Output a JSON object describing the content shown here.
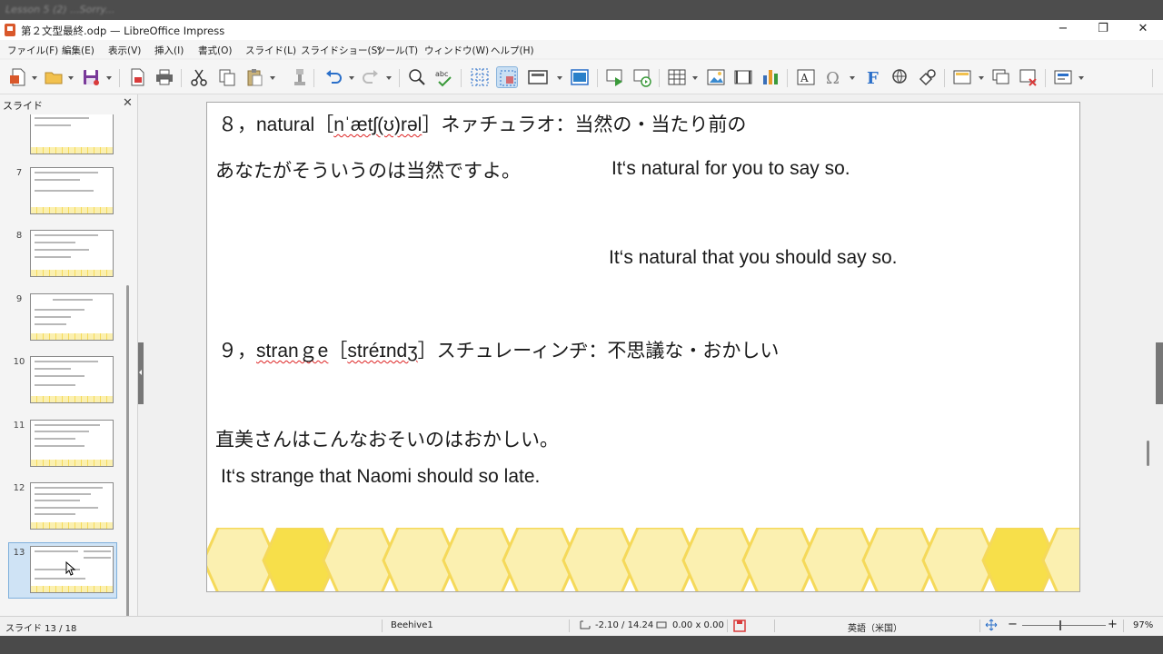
{
  "top_strip": {
    "text": "Lesson 5 (2) ...Sorry..."
  },
  "window": {
    "title": "第２文型最終.odp — LibreOffice Impress",
    "controls": {
      "minimize": "−",
      "maximize": "❐",
      "close": "✕"
    }
  },
  "menu": [
    "ファイル(F)",
    "編集(E)",
    "表示(V)",
    "挿入(I)",
    "書式(O)",
    "スライド(L)",
    "スライドショー(S)",
    "ツール(T)",
    "ウィンドウ(W)",
    "ヘルプ(H)"
  ],
  "toolbar_icons": [
    "new-document-icon",
    "open-folder-icon",
    "save-icon",
    "export-pdf-icon",
    "print-icon",
    "cut-icon",
    "copy-icon",
    "paste-icon",
    "clone-format-icon",
    "undo-icon",
    "redo-icon",
    "find-replace-icon",
    "spellcheck-icon",
    "display-grid-icon",
    "helplines-icon",
    "slide-layout-icon",
    "master-slide-icon",
    "start-first-slide-icon",
    "start-current-slide-icon",
    "table-icon",
    "image-icon",
    "media-icon",
    "chart-icon",
    "textbox-icon",
    "special-character-icon",
    "fontwork-icon",
    "hyperlink-icon",
    "shapes-icon",
    "header-footer-icon",
    "new-slide-icon",
    "delete-slide-icon",
    "slide-layout-menu-icon"
  ],
  "slide_pane": {
    "title": "スライド",
    "close": "✕",
    "thumbnails": [
      "7",
      "8",
      "9",
      "10",
      "11",
      "12",
      "13"
    ],
    "selected": "13"
  },
  "slide": {
    "line1_num": "８，",
    "line1_word": "natural",
    "line1_ipa_open": "［",
    "line1_ipa": "nˈætʃ(ʊ)rəl",
    "line1_ipa_close": "］",
    "line1_rest": "ネァチュラオ：当然の・当たり前の",
    "line2_jp": "あなたがそういうのは当然ですよ。",
    "line2_en": "It‘s natural for you to say so.",
    "line3_en": "It‘s natural that you should say so.",
    "line4_num": "９，",
    "line4_word": "stranｇe",
    "line4_ipa_open": "［",
    "line4_ipa": "stréɪndʒ",
    "line4_ipa_close": "］",
    "line4_rest": "スチュレーィンヂ：不思議な・おかしい",
    "line5_jp": "直美さんはこんなおそいのはおかしい。",
    "line6_en": "It‘s strange that Naomi should so late."
  },
  "status": {
    "slide": "スライド 13 / 18",
    "master": "Beehive1",
    "position": "-2.10 / 14.24",
    "size": "0.00 x 0.00",
    "language": "英語（米国）",
    "zoom_minus": "−",
    "zoom_plus": "+",
    "zoom": "97%"
  },
  "colors": {
    "honey_light": "#fbf0b0",
    "honey_mid": "#f5d95a",
    "honey_strong": "#f7df4a",
    "selection": "#cfe3f5"
  }
}
